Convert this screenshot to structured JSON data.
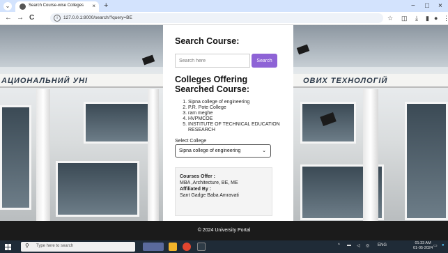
{
  "browser": {
    "tab_title": "Search Course-wise Colleges",
    "tab_close": "×",
    "new_tab": "+",
    "window_minimize": "−",
    "window_maximize": "□",
    "window_close": "×",
    "back": "←",
    "forward": "→",
    "reload": "C",
    "url": "127.0.0.1:8000/search/?query=BE"
  },
  "page": {
    "search_heading": "Search Course:",
    "search_placeholder": "Search here",
    "search_button": "Search",
    "colleges_heading": "Colleges Offering Searched Course:",
    "colleges": [
      "Sipna college of engineering",
      "P.R. Pote College",
      "ram meghe",
      "HVPMCOE",
      "INSTITUTE OF TECHNICAL EDUCATION RESEARCH"
    ],
    "select_label": "Select College",
    "selected_college": "Sipna college of engineering",
    "courses_label": "Courses Offer :",
    "courses_value": "MBA ,Architecture, BE, ME",
    "affiliated_label": "Affiliated By :",
    "affiliated_value": "Sant Gadge Baba Amravati",
    "footer": "© 2024 University Portal",
    "facade_left": "АЦИОНАЛЬНИЙ УНІ",
    "facade_right": "ОВИХ ТЕХНОЛОГІЙ"
  },
  "taskbar": {
    "search_placeholder": "Type here to search",
    "language": "ENG",
    "time": "01:33 AM",
    "date": "01-05-2024"
  },
  "colors": {
    "search_button": "#8e63d6",
    "footer_bg": "#1b1b1b",
    "tabstrip_bg": "#d3e3fd",
    "taskbar_bg": "#1f2b37"
  }
}
